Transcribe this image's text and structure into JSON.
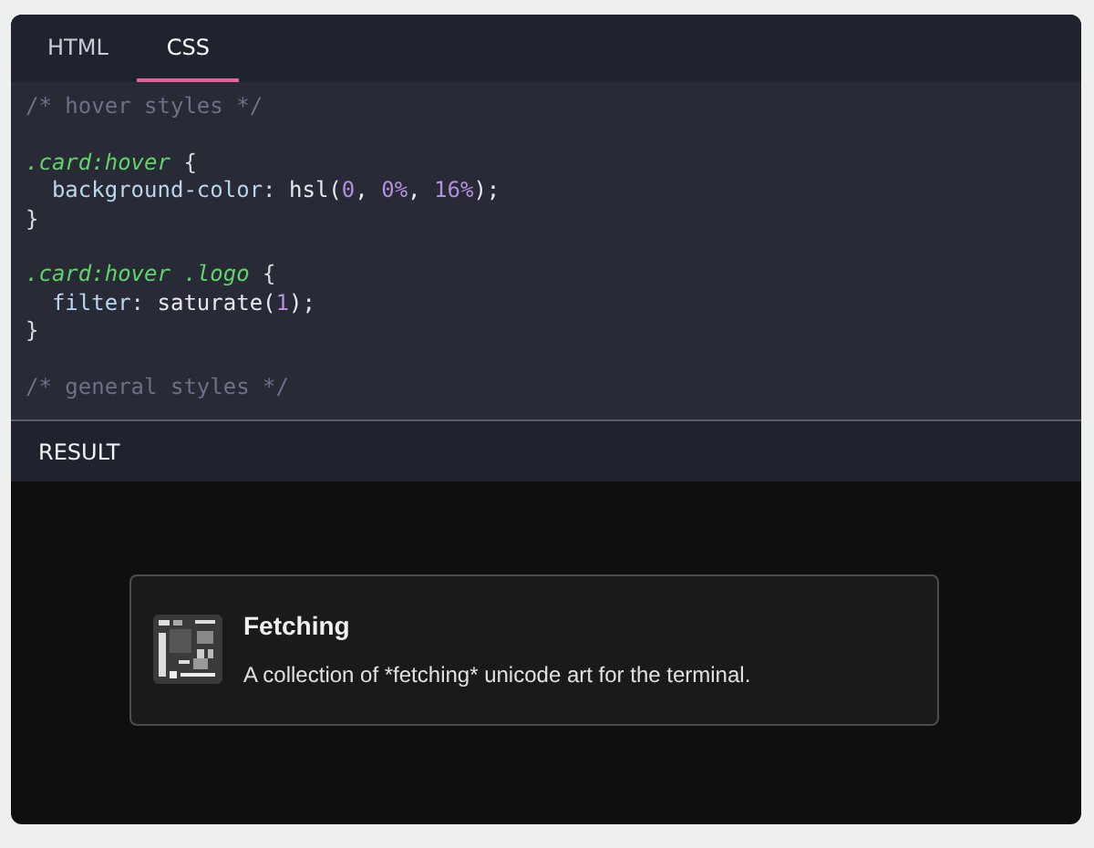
{
  "tabs": [
    {
      "label": "HTML",
      "selected": false
    },
    {
      "label": "CSS",
      "selected": true
    }
  ],
  "code": [
    {
      "kind": "code",
      "tokens": [
        {
          "kind": "comment",
          "text": "/* hover styles */"
        }
      ]
    },
    {
      "kind": "blank"
    },
    {
      "kind": "code",
      "tokens": [
        {
          "kind": "selector",
          "text": ".card:hover"
        },
        {
          "kind": "punct",
          "text": " {"
        }
      ]
    },
    {
      "kind": "code",
      "tokens": [
        {
          "kind": "property",
          "text": "  background-color"
        },
        {
          "kind": "punct",
          "text": ": "
        },
        {
          "kind": "plain",
          "text": "hsl("
        },
        {
          "kind": "number",
          "text": "0"
        },
        {
          "kind": "plain",
          "text": ", "
        },
        {
          "kind": "number",
          "text": "0%"
        },
        {
          "kind": "plain",
          "text": ", "
        },
        {
          "kind": "number",
          "text": "16%"
        },
        {
          "kind": "plain",
          "text": ");"
        }
      ]
    },
    {
      "kind": "code",
      "tokens": [
        {
          "kind": "punct",
          "text": "}"
        }
      ]
    },
    {
      "kind": "blank"
    },
    {
      "kind": "code",
      "tokens": [
        {
          "kind": "selector",
          "text": ".card:hover .logo"
        },
        {
          "kind": "punct",
          "text": " {"
        }
      ]
    },
    {
      "kind": "code",
      "tokens": [
        {
          "kind": "property",
          "text": "  filter"
        },
        {
          "kind": "punct",
          "text": ": "
        },
        {
          "kind": "plain",
          "text": "saturate("
        },
        {
          "kind": "number",
          "text": "1"
        },
        {
          "kind": "plain",
          "text": ");"
        }
      ]
    },
    {
      "kind": "code",
      "tokens": [
        {
          "kind": "punct",
          "text": "}"
        }
      ]
    },
    {
      "kind": "blank"
    },
    {
      "kind": "code",
      "tokens": [
        {
          "kind": "comment",
          "text": "/* general styles */"
        }
      ]
    }
  ],
  "result": {
    "label": "RESULT",
    "card": {
      "title": "Fetching",
      "description": "A collection of *fetching* unicode art for the terminal."
    }
  }
}
